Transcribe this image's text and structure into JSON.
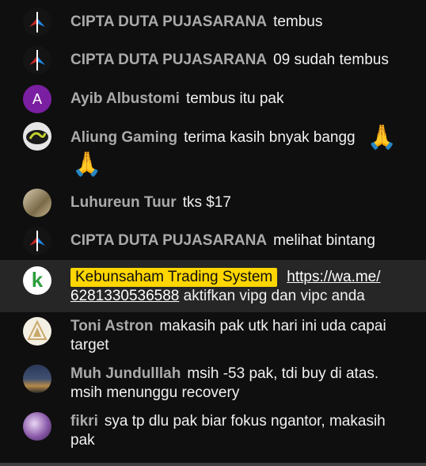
{
  "messages": [
    {
      "author": "CIPTA DUTA PUJASARANA",
      "text": "tembus"
    },
    {
      "author": "CIPTA DUTA PUJASARANA",
      "text": "09 sudah tembus"
    },
    {
      "author": "Ayib Albustomi",
      "text": "tembus itu pak",
      "avatar_letter": "A",
      "avatar_color": "#7b1fa2"
    },
    {
      "author": "Aliung Gaming",
      "text": "terima kasih bnyak bangg",
      "emoji": "🙏"
    },
    {
      "author": "Luhureun Tuur",
      "text": "tks $17"
    },
    {
      "author": "CIPTA DUTA PUJASARANA",
      "text": "melihat bintang"
    },
    {
      "author": "Kebunsaham Trading System",
      "link_part1": "https://wa.me/",
      "link_part2": "6281330536588",
      "text": "aktifkan vipg dan vipc anda",
      "avatar_letter": "k",
      "badge_color": "#ffd600"
    },
    {
      "author": "Toni Astron",
      "text": "makasih pak utk hari ini uda capai target"
    },
    {
      "author": "Muh Jundulllah",
      "text": "msih -53 pak, tdi buy di atas. msih menunggu recovery"
    },
    {
      "author": "fikri",
      "text": "sya tp dlu pak biar fokus ngantor, makasih pak"
    }
  ]
}
